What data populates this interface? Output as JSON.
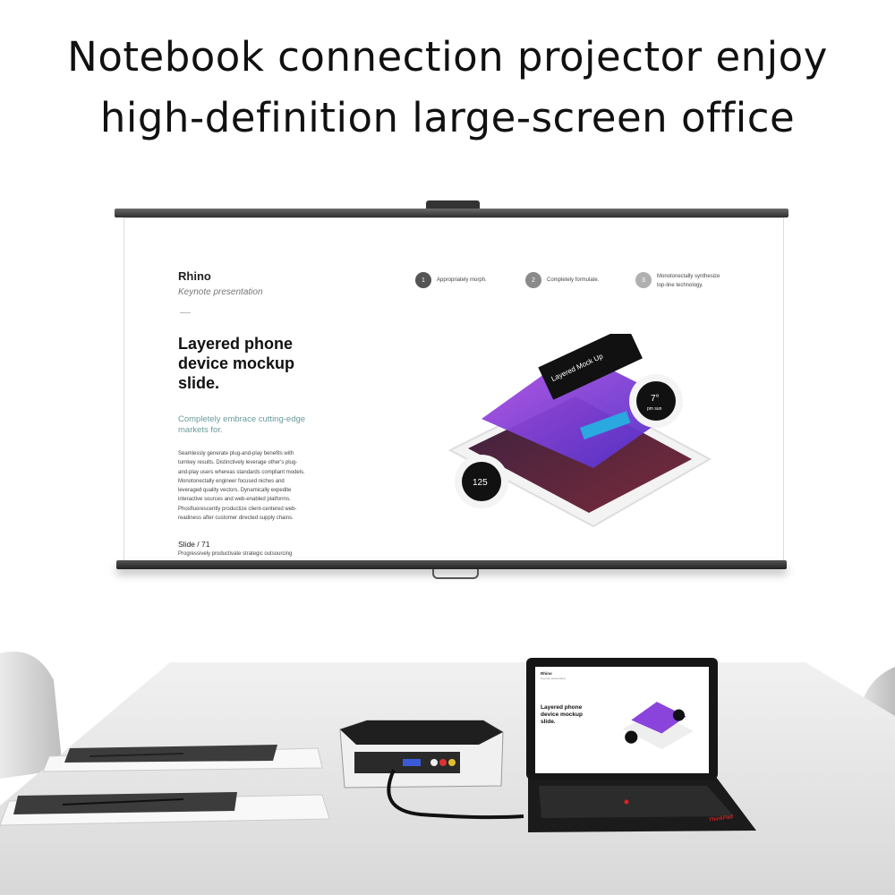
{
  "headline": {
    "line1": "Notebook connection projector enjoy",
    "line2": "high-definition large-screen office"
  },
  "slide": {
    "title": "Rhino",
    "subtitle": "Keynote presentation",
    "heading": "Layered phone device mockup slide.",
    "tagline": "Completely embrace cutting-edge markets for.",
    "body": "Seamlessly generate plug-and-play benefits with turnkey results. Distinctively leverage other's plug-and-play users whereas standards compliant models. Monotonectally engineer focused niches and leveraged quality vectors. Dynamically expedite interactive sources and web-enabled platforms. Phosfluorescently productize client-centered web-readiness after customer directed supply chains.",
    "slide_label": "Slide / 71",
    "slide_desc": "Progressively productivate strategic outsourcing",
    "steps": [
      {
        "num": "1",
        "text": "Appropriately morph.",
        "color": "#555555"
      },
      {
        "num": "2",
        "text": "Completely formulate.",
        "color": "#8a8a8a"
      },
      {
        "num": "3",
        "text": "Monotonectally synthesize top-line technology.",
        "color": "#b0b0b0"
      }
    ],
    "mockup": {
      "card_label": "Layered Mock Up",
      "badge_top": "7°",
      "badge_top_sub": "pm sun",
      "badge_bottom": "125"
    }
  },
  "laptop": {
    "title": "Rhino",
    "subtitle": "Keynote presentation",
    "heading": "Layered phone device mockup slide.",
    "brand": "ThinkPad"
  },
  "colors": {
    "accent_purple": "#7b3fe4",
    "accent_blue": "#2aa8e0",
    "accent_pink": "#e04a8a"
  }
}
